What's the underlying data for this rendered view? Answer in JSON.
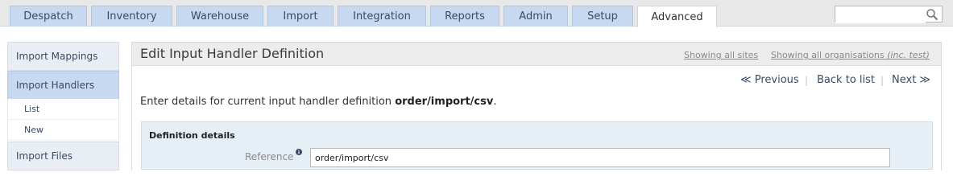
{
  "nav": {
    "tabs": [
      {
        "label": "Despatch"
      },
      {
        "label": "Inventory"
      },
      {
        "label": "Warehouse"
      },
      {
        "label": "Import"
      },
      {
        "label": "Integration"
      },
      {
        "label": "Reports"
      },
      {
        "label": "Admin"
      },
      {
        "label": "Setup"
      },
      {
        "label": "Advanced",
        "active": true
      }
    ],
    "search": {
      "value": "",
      "icon": "search-icon"
    }
  },
  "sidebar": {
    "import_mappings": "Import Mappings",
    "import_handlers": "Import Handlers",
    "list": "List",
    "new": "New",
    "import_files": "Import Files"
  },
  "panel": {
    "title": "Edit Input Handler Definition",
    "showing_sites": "Showing all sites",
    "showing_orgs": "Showing all organisations",
    "showing_orgs_note": "(inc. test)",
    "previous": "≪ Previous",
    "back": "Back to list",
    "next": "Next ≫",
    "separator": "|",
    "intro_prefix": "Enter details for current input handler definition ",
    "intro_name": "order/import/csv",
    "intro_suffix": "."
  },
  "definition": {
    "title": "Definition details",
    "reference_label": "Reference",
    "reference_value": "order/import/csv"
  },
  "colors": {
    "tab_bg": "#c7d9f1",
    "nav_text": "#394b63",
    "def_box_bg": "#e6eef6"
  }
}
